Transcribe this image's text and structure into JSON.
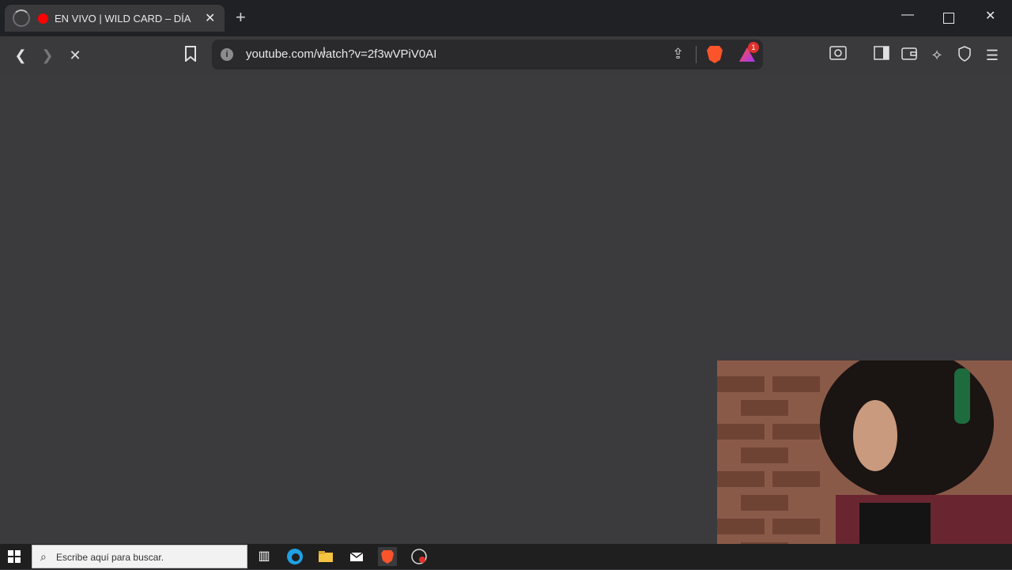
{
  "browser": {
    "tab": {
      "title": "EN VIVO | WILD CARD – DÍA"
    },
    "address": {
      "url": "youtube.com/watch?v=2f3wVPiV0AI"
    },
    "rewards_badge": "1"
  },
  "taskbar": {
    "search_placeholder": "Escribe aquí para buscar."
  },
  "colors": {
    "titlebar": "#202124",
    "toolbar": "#3a3a3d",
    "content": "#3b3b3e",
    "youtube_red": "#ff0000",
    "brave_orange": "#fb542b"
  },
  "icons": [
    "loading-spinner-icon",
    "youtube-favicon-icon",
    "close-tab-icon",
    "new-tab-icon",
    "minimize-icon",
    "restore-icon",
    "close-window-icon",
    "back-icon",
    "forward-icon",
    "stop-icon",
    "bookmark-icon",
    "site-info-icon",
    "share-icon",
    "brave-shields-icon",
    "brave-rewards-icon",
    "screenshot-icon",
    "sidebar-icon",
    "wallet-icon",
    "leo-ai-icon",
    "vpn-icon",
    "menu-icon",
    "windows-start-icon",
    "search-icon",
    "task-view-icon",
    "edge-icon",
    "file-explorer-icon",
    "mail-icon",
    "brave-app-icon",
    "obs-icon"
  ]
}
